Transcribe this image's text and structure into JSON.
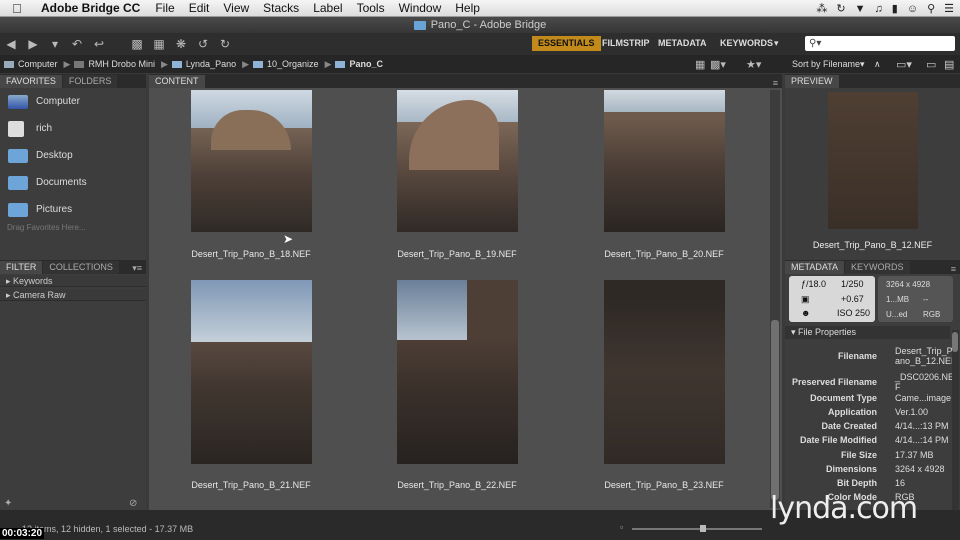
{
  "menubar": {
    "apple": "",
    "app_name": "Adobe Bridge CC",
    "items": [
      "File",
      "Edit",
      "View",
      "Stacks",
      "Label",
      "Tools",
      "Window",
      "Help"
    ]
  },
  "window": {
    "title": "Pano_C - Adobe Bridge"
  },
  "workspaces": {
    "essentials": "ESSENTIALS",
    "filmstrip": "FILMSTRIP",
    "metadata": "METADATA",
    "keywords": "KEYWORDS"
  },
  "search": {
    "placeholder": ""
  },
  "path": [
    "Computer",
    "RMH Drobo Mini",
    "Lynda_Pano",
    "10_Organize",
    "Pano_C"
  ],
  "sort": {
    "label": "Sort by Filename"
  },
  "left": {
    "tabs": {
      "favorites": "FAVORITES",
      "folders": "FOLDERS"
    },
    "favorites": [
      "Computer",
      "rich",
      "Desktop",
      "Documents",
      "Pictures"
    ],
    "drag_hint": "Drag Favorites Here...",
    "filter_tabs": {
      "filter": "FILTER",
      "collections": "COLLECTIONS"
    },
    "filter_items": [
      "Keywords",
      "Camera Raw"
    ]
  },
  "content": {
    "tab": "CONTENT",
    "thumbnails": [
      "Desert_Trip_Pano_B_18.NEF",
      "Desert_Trip_Pano_B_19.NEF",
      "Desert_Trip_Pano_B_20.NEF",
      "Desert_Trip_Pano_B_21.NEF",
      "Desert_Trip_Pano_B_22.NEF",
      "Desert_Trip_Pano_B_23.NEF"
    ]
  },
  "preview": {
    "tab": "PREVIEW",
    "caption": "Desert_Trip_Pano_B_12.NEF"
  },
  "metadata_panel": {
    "tabs": {
      "metadata": "METADATA",
      "keywords": "KEYWORDS"
    },
    "aperture": "ƒ/18.0",
    "shutter": "1/250",
    "exposure": "+0.67",
    "iso": "ISO 250",
    "dims": "3264 x 4928",
    "size": "1...MB",
    "size2": "--",
    "color1": "U...ed",
    "color2": "RGB",
    "section": "File Properties",
    "rows": [
      {
        "k": "Filename",
        "v": "Desert_Trip_P",
        "v2": "ano_B_12.NEF"
      },
      {
        "k": "Preserved Filename",
        "v": "_DSC0206.NE",
        "v2": "F"
      },
      {
        "k": "Document Type",
        "v": "Came...image"
      },
      {
        "k": "Application",
        "v": "Ver.1.00"
      },
      {
        "k": "Date Created",
        "v": "4/14...:13 PM"
      },
      {
        "k": "Date File Modified",
        "v": "4/14...:14 PM"
      },
      {
        "k": "File Size",
        "v": "17.37 MB"
      },
      {
        "k": "Dimensions",
        "v": "3264 x 4928"
      },
      {
        "k": "Bit Depth",
        "v": "16"
      },
      {
        "k": "Color Mode",
        "v": "RGB"
      }
    ]
  },
  "status": {
    "text": "12 items, 12 hidden, 1 selected - 17.37 MB"
  },
  "overlay": {
    "timecode": "00:03:20",
    "logo": "lynda.com"
  }
}
